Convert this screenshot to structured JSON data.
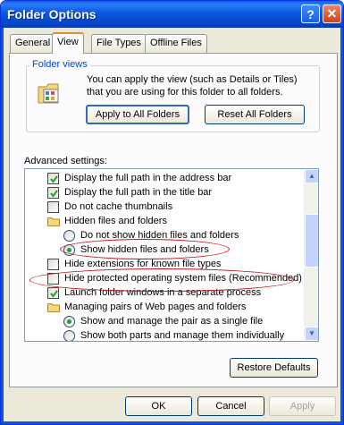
{
  "window": {
    "title": "Folder Options",
    "help_symbol": "?",
    "close_symbol": "✕"
  },
  "tabs": [
    {
      "label": "General",
      "active": false
    },
    {
      "label": "View",
      "active": true
    },
    {
      "label": "File Types",
      "active": false
    },
    {
      "label": "Offline Files",
      "active": false
    }
  ],
  "folder_views": {
    "legend": "Folder views",
    "description": "You can apply the view (such as Details or Tiles) that you are using for this folder to all folders.",
    "apply_button": "Apply to All Folders",
    "reset_button": "Reset All Folders"
  },
  "advanced": {
    "label": "Advanced settings:",
    "items": [
      {
        "type": "checkbox",
        "checked": true,
        "label": "Display the full path in the address bar"
      },
      {
        "type": "checkbox",
        "checked": true,
        "label": "Display the full path in the title bar"
      },
      {
        "type": "checkbox",
        "checked": false,
        "label": "Do not cache thumbnails"
      },
      {
        "type": "folder",
        "label": "Hidden files and folders"
      },
      {
        "type": "radio",
        "selected": false,
        "label": "Do not show hidden files and folders"
      },
      {
        "type": "radio",
        "selected": true,
        "label": "Show hidden files and folders"
      },
      {
        "type": "checkbox",
        "checked": false,
        "label": "Hide extensions for known file types"
      },
      {
        "type": "checkbox",
        "checked": false,
        "label": "Hide protected operating system files (Recommended)"
      },
      {
        "type": "checkbox",
        "checked": true,
        "label": "Launch folder windows in a separate process"
      },
      {
        "type": "folder",
        "label": "Managing pairs of Web pages and folders"
      },
      {
        "type": "radio",
        "selected": true,
        "label": "Show and manage the pair as a single file"
      },
      {
        "type": "radio",
        "selected": false,
        "label": "Show both parts and manage them individually"
      }
    ],
    "restore_button": "Restore Defaults"
  },
  "footer": {
    "ok": "OK",
    "cancel": "Cancel",
    "apply": "Apply"
  },
  "colors": {
    "title_blue": "#0a58e0",
    "highlight_ellipse": "#c0141a",
    "check_green": "#21a121"
  }
}
